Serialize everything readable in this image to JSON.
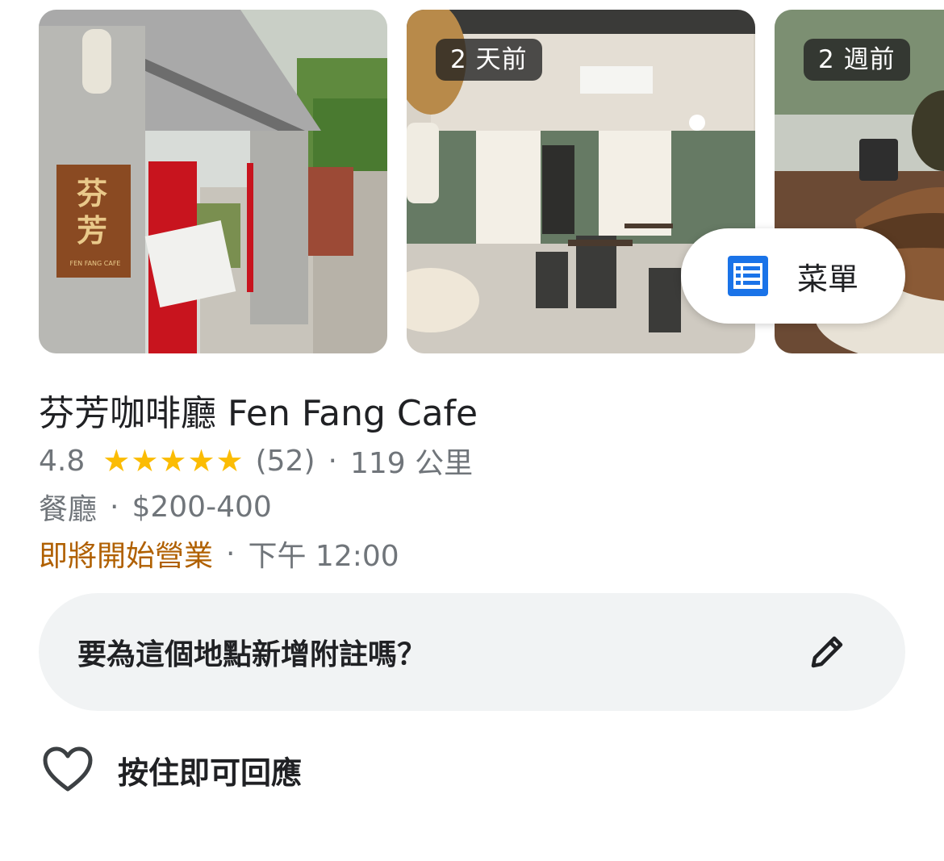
{
  "photos": [
    {
      "badge": ""
    },
    {
      "badge": "2 天前"
    },
    {
      "badge": "2 週前"
    }
  ],
  "menu_button": {
    "label": "菜單",
    "icon": "list-icon",
    "icon_color": "#1a73e8"
  },
  "sign_text": "芬芳",
  "sign_subtext": "FEN FANG CAFE",
  "place": {
    "name": "芬芳咖啡廳 Fen Fang Cafe",
    "rating": "4.8",
    "stars": "★★★★★",
    "review_count": "(52)",
    "separator": "·",
    "distance": "119 公里",
    "category": "餐廳",
    "price": "$200-400",
    "status": "即將開始營業",
    "open_time": "下午 12:00"
  },
  "note": {
    "prompt": "要為這個地點新增附註嗎？",
    "icon": "pencil-icon"
  },
  "like": {
    "label": "按住即可回應",
    "icon": "heart-outline-icon"
  },
  "colors": {
    "star": "#fbbc04",
    "status": "#b06000",
    "note_bg": "#f1f3f4",
    "accent": "#1a73e8"
  }
}
